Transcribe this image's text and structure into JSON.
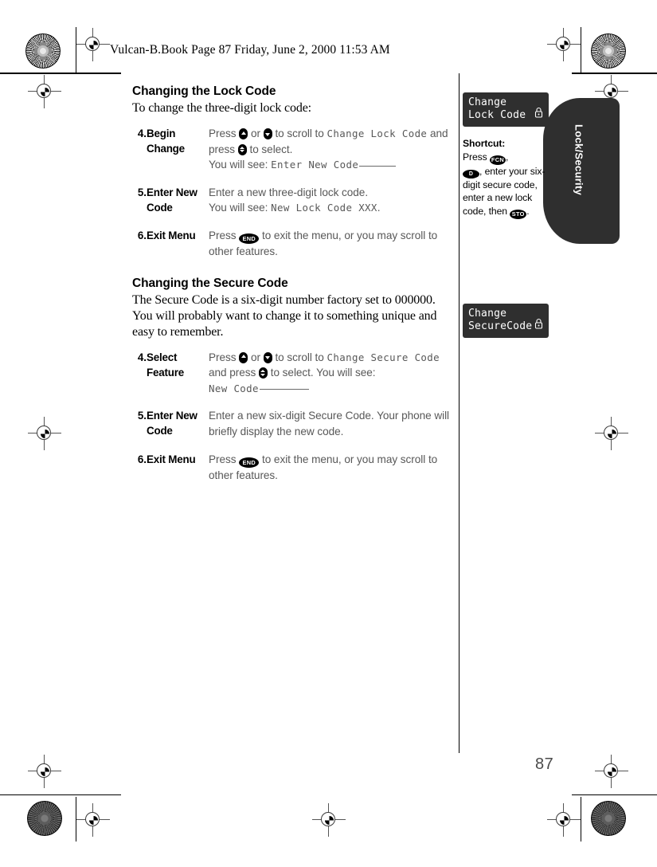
{
  "header": {
    "file_line": "Vulcan-B.Book  Page 87  Friday, June 2, 2000  11:53 AM"
  },
  "page_number": "87",
  "main": {
    "section1": {
      "heading": "Changing the Lock Code",
      "intro": "To change the three-digit lock code:",
      "steps": [
        {
          "number": "4.",
          "label": "Begin Change",
          "desc_pre": "Press",
          "desc_mid": "or",
          "desc_post": "to scroll to",
          "lcd1": "Change Lock Code",
          "desc_and": "and press",
          "desc_sel": "to select.",
          "desc_see": "You will see:",
          "lcd2": "Enter New Code"
        },
        {
          "number": "5.",
          "label": "Enter New Code",
          "line1": "Enter a new three-digit lock code.",
          "line2_pre": "You will see:",
          "lcd1": "New Lock Code XXX",
          "line2_post": "."
        },
        {
          "number": "6.",
          "label": "Exit Menu",
          "desc_pre": "Press",
          "key": "END",
          "desc_post": "to exit the menu, or you may scroll to other features."
        }
      ]
    },
    "section2": {
      "heading": "Changing the Secure Code",
      "intro": "The Secure Code is a six-digit number factory set to 000000. You will probably want to change it to something unique and easy to remember.",
      "steps": [
        {
          "number": "4.",
          "label": "Select Feature",
          "desc_pre": "Press",
          "desc_mid": "or",
          "desc_post": "to scroll to",
          "lcd1": "Change Secure Code",
          "desc_and": "and press",
          "desc_sel": "to select. You will see:",
          "lcd2": "New Code"
        },
        {
          "number": "5.",
          "label": "Enter New Code",
          "line1": "Enter a new six-digit Secure Code. Your phone will briefly display the new code."
        },
        {
          "number": "6.",
          "label": "Exit Menu",
          "desc_pre": "Press",
          "key": "END",
          "desc_post": "to exit the menu, or you may scroll to other features."
        }
      ]
    }
  },
  "sidebar": {
    "lcd_box_1": {
      "line1": "Change",
      "line2": "Lock Code"
    },
    "lcd_box_2": {
      "line1": "Change",
      "line2": "SecureCode"
    },
    "shortcut": {
      "title": "Shortcut:",
      "press": "Press",
      "key_fcn": "FCN",
      "comma": ",",
      "key_d": "D",
      "text1": ", enter your six-digit secure code, enter a new lock code, then",
      "key_sto": "STO",
      "period": "."
    },
    "tab_label": "Lock/Security"
  },
  "colors": {
    "lcd_bg": "#2f2f2f",
    "body_text": "#585858",
    "page_number": "#4a4a4a"
  }
}
